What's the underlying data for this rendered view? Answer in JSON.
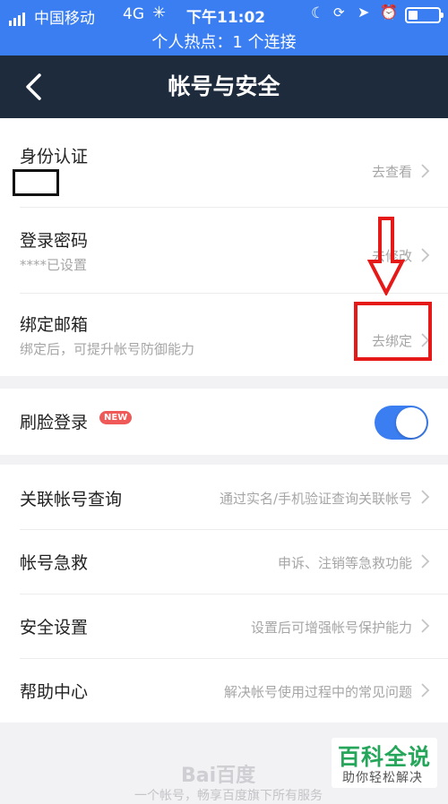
{
  "status_bar": {
    "carrier": "中国移动",
    "network": "4G",
    "time": "下午11:02",
    "hotspot": "个人热点：1 个连接"
  },
  "nav": {
    "title": "帐号与安全",
    "back_icon": "chevron-left-icon"
  },
  "account_group": [
    {
      "label": "身份认证",
      "sub": "",
      "action": "去查看"
    },
    {
      "label": "登录密码",
      "sub": "****已设置",
      "action": "去修改"
    },
    {
      "label": "绑定邮箱",
      "sub": "绑定后，可提升帐号防御能力",
      "action": "去绑定"
    }
  ],
  "face_login": {
    "label": "刷脸登录",
    "badge": "NEW",
    "enabled": true
  },
  "more_group": [
    {
      "label": "关联帐号查询",
      "action": "通过实名/手机验证查询关联帐号"
    },
    {
      "label": "帐号急救",
      "action": "申诉、注销等急救功能"
    },
    {
      "label": "安全设置",
      "action": "设置后可增强帐号保护能力"
    },
    {
      "label": "帮助中心",
      "action": "解决帐号使用过程中的常见问题"
    }
  ],
  "footer": {
    "logo_text": "Bai百度",
    "text": "一个帐号，畅享百度旗下所有服务"
  },
  "watermark": {
    "title": "百科全说",
    "subtitle": "助你轻松解决"
  },
  "colors": {
    "accent": "#3b7ef1",
    "nav_bg": "#1d2b3c",
    "annotation": "#e61919",
    "badge": "#ef5a58",
    "watermark": "#26a65b"
  }
}
